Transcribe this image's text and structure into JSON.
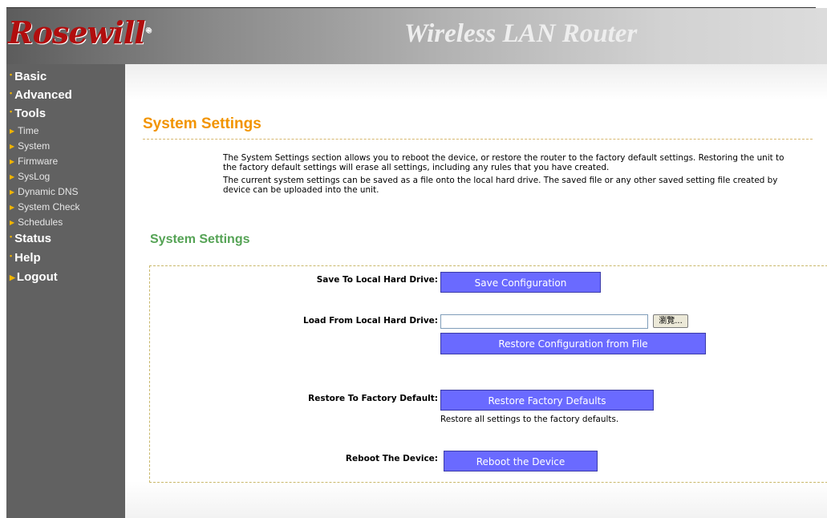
{
  "header": {
    "logo_text": "Rosewill",
    "logo_mark": "®",
    "product_title": "Wireless LAN Router"
  },
  "sidebar": {
    "basic": "Basic",
    "advanced": "Advanced",
    "tools": "Tools",
    "tools_items": [
      "Time",
      "System",
      "Firmware",
      "SysLog",
      "Dynamic DNS",
      "System Check",
      "Schedules"
    ],
    "status": "Status",
    "help": "Help",
    "logout": "Logout"
  },
  "main": {
    "page_title": "System Settings",
    "description": [
      "The System Settings section allows you to reboot the device, or restore the router to the factory default settings. Restoring the unit to",
      "the factory default settings will erase all settings, including any rules that you have created.",
      "The current system settings can be saved as a file onto the local hard drive. The saved file or any other saved setting file created by",
      "device can be uploaded into the unit."
    ],
    "section_title": "System Settings",
    "save": {
      "label": "Save To Local Hard Drive:",
      "button": "Save Configuration"
    },
    "load": {
      "label": "Load From Local Hard Drive:",
      "file_value": "",
      "browse_button": "瀏覽...",
      "button": "Restore Configuration from File"
    },
    "factory": {
      "label": "Restore To Factory Default:",
      "button": "Restore Factory Defaults",
      "hint": "Restore all settings to the factory defaults."
    },
    "reboot": {
      "label": "Reboot The Device:",
      "button": "Reboot the Device"
    }
  },
  "colors": {
    "accent_title": "#f29400",
    "section_title": "#55a355",
    "button_bg": "#6a6aff",
    "sidebar_bg": "#616161",
    "logo": "#b10e0e"
  }
}
